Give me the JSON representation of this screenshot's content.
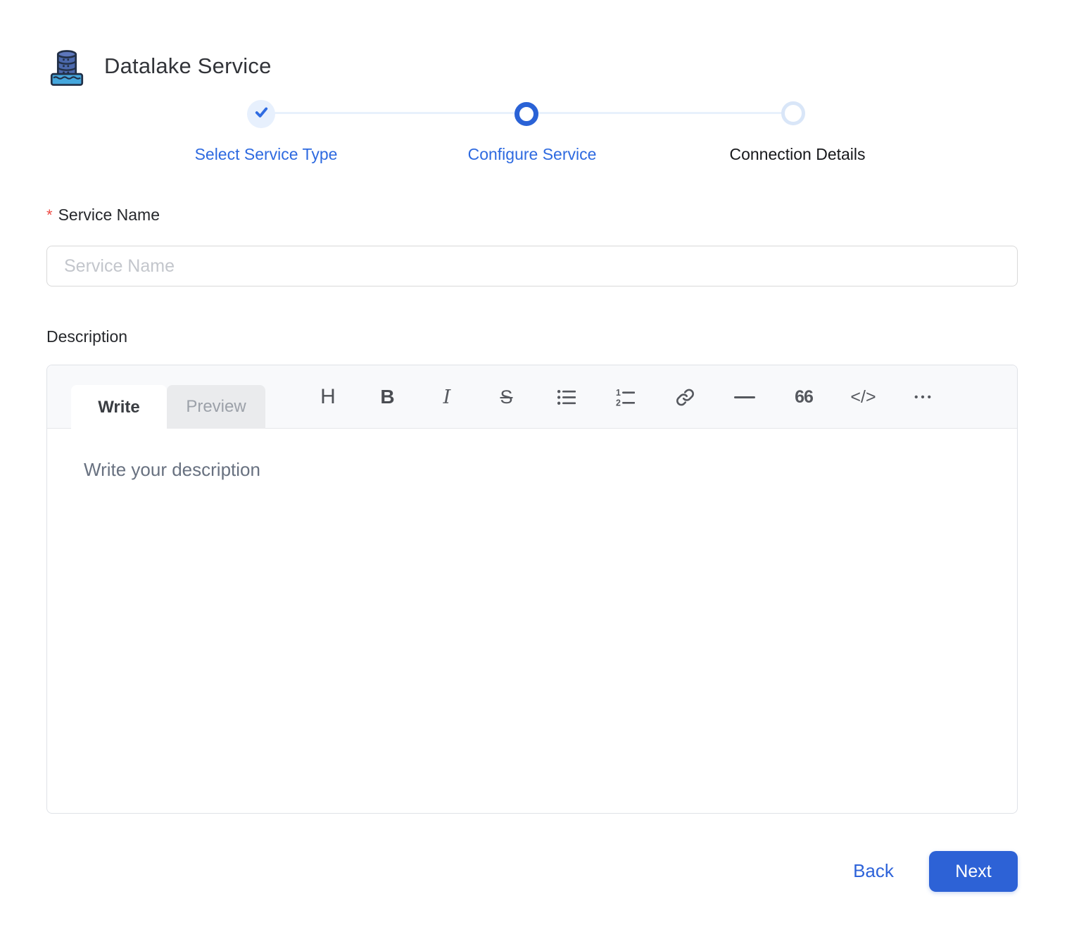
{
  "header": {
    "title": "Datalake Service",
    "icon": "datalake-icon"
  },
  "stepper": {
    "steps": [
      {
        "label": "Select Service Type",
        "state": "completed"
      },
      {
        "label": "Configure Service",
        "state": "active"
      },
      {
        "label": "Connection Details",
        "state": "upcoming"
      }
    ]
  },
  "form": {
    "service_name": {
      "label": "Service Name",
      "required_marker": "*",
      "placeholder": "Service Name",
      "value": ""
    },
    "description": {
      "label": "Description",
      "editor": {
        "tabs": [
          {
            "label": "Write",
            "active": true
          },
          {
            "label": "Preview",
            "active": false
          }
        ],
        "toolbar": {
          "heading_glyph": "H",
          "bold_glyph": "B",
          "italic_glyph": "I",
          "strikethrough_glyph": "S",
          "quote_glyph": "66",
          "code_glyph": "</>",
          "more_glyph": "•••",
          "icon_names": [
            "heading-icon",
            "bold-icon",
            "italic-icon",
            "strikethrough-icon",
            "unordered-list-icon",
            "ordered-list-icon",
            "link-icon",
            "horizontal-rule-icon",
            "quote-icon",
            "code-icon",
            "more-icon"
          ]
        },
        "placeholder": "Write your description",
        "value": ""
      }
    }
  },
  "actions": {
    "back_label": "Back",
    "next_label": "Next"
  },
  "colors": {
    "accent_blue": "#2e6ae0",
    "active_ring_blue": "#2a62d6",
    "completed_circle_bg": "#e7f0fd",
    "step_line": "#e8f1fc",
    "upcoming_ring": "#d9e6f8",
    "required_red": "#ee4b45",
    "input_placeholder": "#c3c6cc",
    "editor_header_bg": "#f8f9fb",
    "next_button_bg": "#2d62d6"
  }
}
